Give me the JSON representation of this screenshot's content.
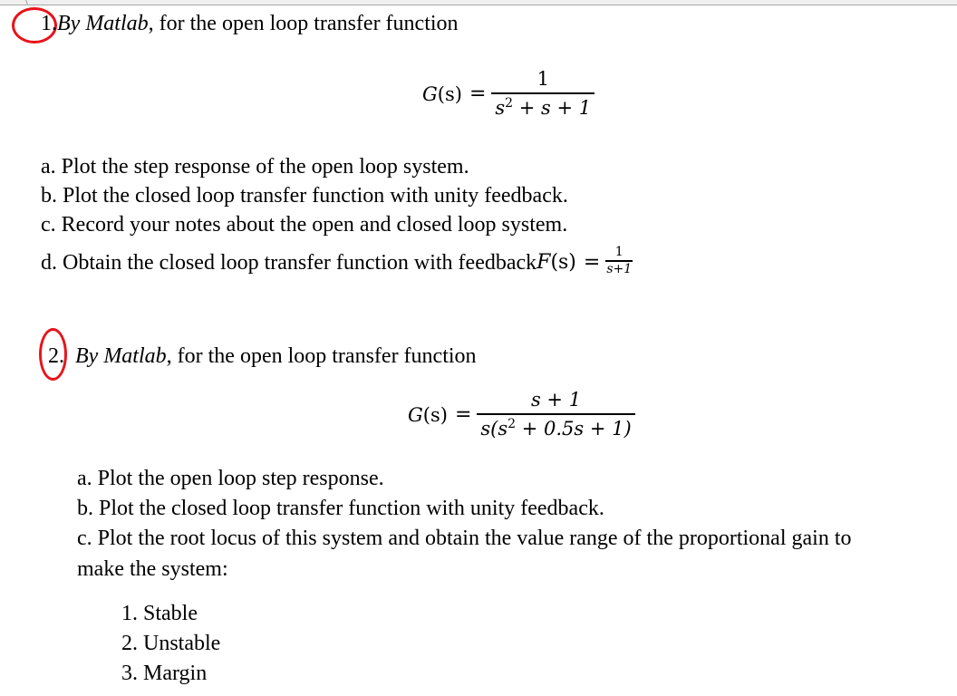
{
  "problem1": {
    "number": "1.",
    "intro_italic": "By Matlab",
    "intro_rest": ", for the open loop transfer function",
    "equation": {
      "lhs_func": "G",
      "lhs_arg": "(s)",
      "equals": "=",
      "numerator": "1",
      "denominator_base": "s",
      "denominator_exp": "2",
      "denominator_rest": " + s + 1"
    },
    "items": [
      {
        "label": "a.",
        "text": "Plot the step response of the open loop system."
      },
      {
        "label": "b.",
        "text": "Plot the closed loop transfer function with unity feedback."
      },
      {
        "label": "c.",
        "text": "Record your notes about the open and closed loop system."
      },
      {
        "label": "d.",
        "text": "Obtain the closed loop transfer function with feedback "
      }
    ],
    "feedback": {
      "func": "F",
      "arg": "(s)",
      "equals": "=",
      "numerator": "1",
      "denominator": "s+1"
    }
  },
  "problem2": {
    "number": "2.",
    "intro_italic": "By Matlab",
    "intro_rest": ", for the open loop transfer function",
    "equation": {
      "lhs_func": "G",
      "lhs_arg": "(s)",
      "equals": "=",
      "numerator": "s + 1",
      "denominator_pre": "s(s",
      "denominator_exp": "2",
      "denominator_post": " + 0.5s + 1)"
    },
    "items": [
      {
        "label": "a.",
        "text": "Plot the open loop step response."
      },
      {
        "label": "b.",
        "text": "Plot the closed loop transfer function with unity feedback."
      },
      {
        "label": "c.",
        "text": "Plot the root locus of this system and obtain the value range of the proportional gain to"
      },
      {
        "label": "",
        "text": "make the system:"
      }
    ],
    "subitems": [
      "1. Stable",
      "2. Unstable",
      "3. Margin"
    ]
  },
  "annotation": {
    "circle_color": "#e8141b"
  }
}
